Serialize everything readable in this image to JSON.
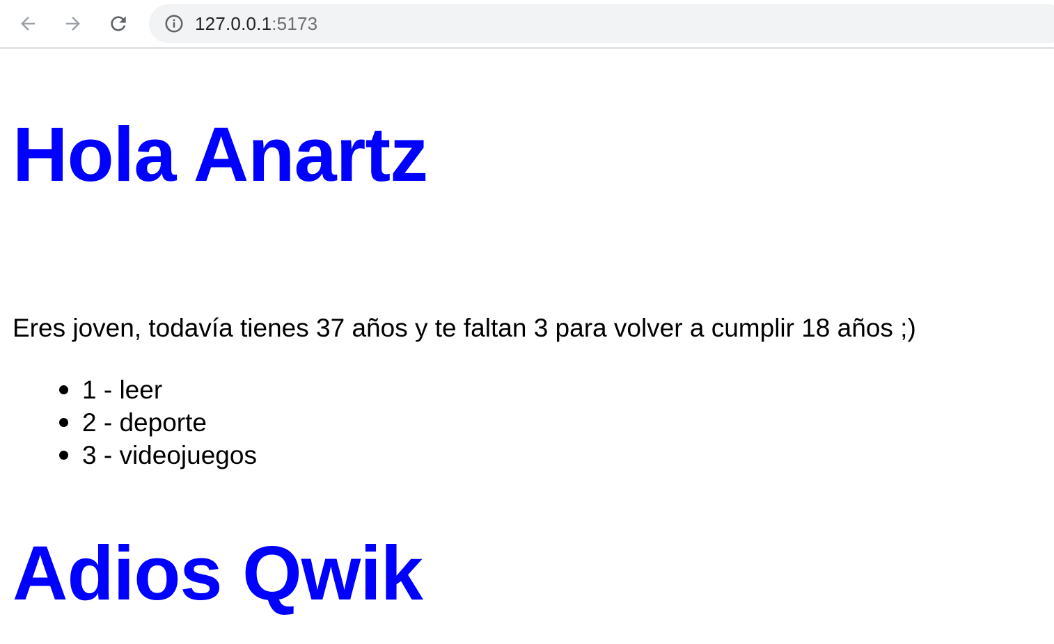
{
  "browser": {
    "back_icon": "arrow-left-icon",
    "forward_icon": "arrow-right-icon",
    "reload_icon": "reload-icon",
    "site_info_icon": "info-icon",
    "url_host": "127.0.0.1",
    "url_port": ":5173"
  },
  "main": {
    "greeting": "Hola Anartz",
    "sentence": "Eres joven, todavía tienes 37 años y te faltan 3 para volver a cumplir 18 años ;)",
    "hobbies": [
      {
        "label": "1 - leer"
      },
      {
        "label": "2 - deporte"
      },
      {
        "label": "3 - videojuegos"
      }
    ],
    "farewell": "Adios Qwik"
  },
  "colors": {
    "heading": "#0000ff",
    "omnibox_bg": "#f1f3f4",
    "icon_disabled": "#9aa0a6",
    "icon_active": "#5f6368"
  }
}
